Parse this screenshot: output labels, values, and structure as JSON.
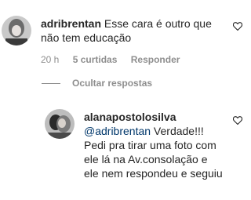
{
  "comment": {
    "username": "adribrentan",
    "text": "Esse cara é outro que não tem educação",
    "time": "20 h",
    "likes": "5 curtidas",
    "reply_label": "Responder"
  },
  "replies_toggle": {
    "label": "Ocultar respostas"
  },
  "reply": {
    "username": "alanapostolosilva",
    "mention": "@adribrentan",
    "text": " Verdade!!! Pedi pra tirar uma foto com ele lá na Av.consolação e ele nem respondeu e seguiu"
  },
  "icons": {
    "like": "heart-outline-icon"
  }
}
